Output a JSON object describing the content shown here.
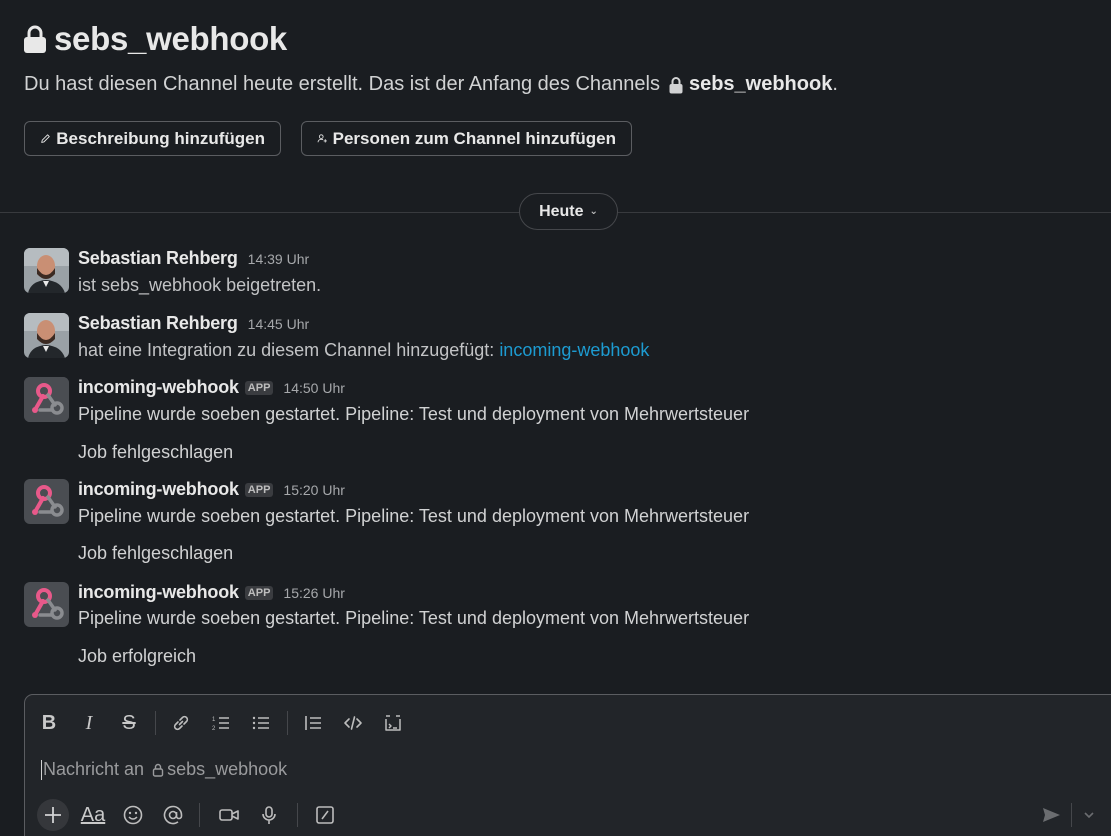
{
  "channel": {
    "name": "sebs_webhook",
    "intro_text": "Du hast diesen Channel heute erstellt. Das ist der Anfang des Channels",
    "intro_channel": "sebs_webhook",
    "intro_end": "."
  },
  "actions": {
    "add_description": "Beschreibung hinzufügen",
    "add_people": "Personen zum Channel hinzufügen"
  },
  "day_divider": {
    "label": "Heute"
  },
  "messages": [
    {
      "author": "Sebastian Rehberg",
      "time": "14:39 Uhr",
      "lines": [
        "ist sebs_webhook beigetreten."
      ]
    },
    {
      "author": "Sebastian Rehberg",
      "time": "14:45 Uhr",
      "text": "hat eine Integration zu diesem Channel hinzugefügt:",
      "link": "incoming-webhook"
    },
    {
      "author": "incoming-webhook",
      "badge": "APP",
      "time": "14:50 Uhr",
      "lines": [
        "Pipeline wurde soeben gestartet. Pipeline: Test und deployment von Mehrwertsteuer",
        "Job fehlgeschlagen"
      ]
    },
    {
      "author": "incoming-webhook",
      "badge": "APP",
      "time": "15:20 Uhr",
      "lines": [
        "Pipeline wurde soeben gestartet. Pipeline: Test und deployment von Mehrwertsteuer",
        "Job fehlgeschlagen"
      ]
    },
    {
      "author": "incoming-webhook",
      "badge": "APP",
      "time": "15:26 Uhr",
      "lines": [
        "Pipeline wurde soeben gestartet. Pipeline: Test und deployment von Mehrwertsteuer",
        "Job erfolgreich"
      ]
    }
  ],
  "composer": {
    "placeholder_prefix": "Nachricht an",
    "placeholder_channel": "sebs_webhook",
    "format_tools": [
      "bold-icon",
      "italic-icon",
      "strikethrough-icon",
      "link-icon",
      "ordered-list-icon",
      "bullet-list-icon",
      "blockquote-icon",
      "code-icon",
      "code-block-icon"
    ],
    "bottom_tools": [
      "plus-icon",
      "text-format-icon",
      "emoji-icon",
      "mention-icon",
      "video-icon",
      "microphone-icon",
      "shortcut-icon",
      "send-icon",
      "chevron-down-icon"
    ],
    "format_label": "Aa"
  },
  "colors": {
    "background": "#1a1d21",
    "link": "#1d9bd1",
    "webhook_pink": "#e8598a"
  }
}
